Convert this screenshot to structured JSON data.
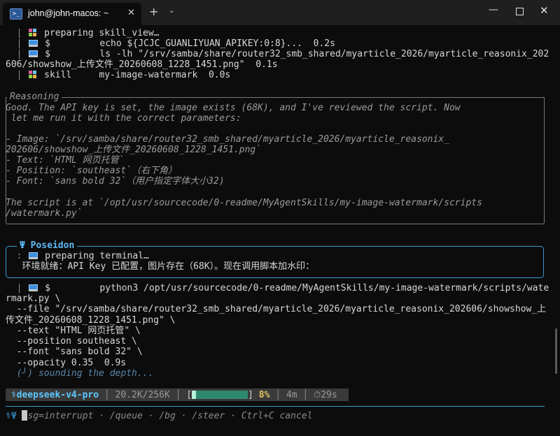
{
  "window": {
    "tab_icon": ">_",
    "tab_title": "john@john-macos: ~",
    "close_tab": "✕",
    "new_tab": "+",
    "dropdown": "⌄",
    "minimize": "—",
    "close": "✕"
  },
  "tool_calls": [
    {
      "pipe": "|",
      "icon": "package-icon",
      "cmd": "preparing skill_view…",
      "cont": ""
    },
    {
      "pipe": "|",
      "icon": "laptop-icon",
      "cmd": "$         echo ${JCJC_GUANLIYUAN_APIKEY:0:8}...  0.2s",
      "cont": ""
    },
    {
      "pipe": "|",
      "icon": "laptop-icon",
      "cmd": "$         ls -lh \"/srv/samba/share/router32_smb_shared/myarticle_2026/myarticle_reasonix_202",
      "cont": "606/showshow_上传文件_20260608_1228_1451.png\"  0.1s"
    },
    {
      "pipe": "|",
      "icon": "package-icon",
      "cmd": "skill     my-image-watermark  0.0s",
      "cont": ""
    }
  ],
  "reasoning": {
    "label": "Reasoning",
    "lines": [
      "Good. The API key is set, the image exists (68K), and I've reviewed the script. Now",
      " let me run it with the correct parameters:",
      "",
      "- Image: `/srv/samba/share/router32_smb_shared/myarticle_2026/myarticle_reasonix_",
      "202606/showshow_上传文件_20260608_1228_1451.png`",
      "- Text: `HTML 网页托管`",
      "- Position: `southeast`（右下角）",
      "- Font: `sans bold 32`（用户指定字体大小32)",
      "",
      "The script is at `/opt/usr/sourcecode/0-readme/MyAgentSkills/my-image-watermark/scripts",
      "/watermark.py`"
    ]
  },
  "poseidon": {
    "label": "Ψ Poseidon",
    "line1": "preparing terminal…",
    "line2": "环境就绪：API Key 已配置，图片存在（68K）。现在调用脚本加水印："
  },
  "command": {
    "lines": [
      "python3 /opt/usr/sourcecode/0-readme/MyAgentSkills/my-image-watermark/scripts/wate",
      "rmark.py \\",
      "  --file \"/srv/samba/share/router32_smb_shared/myarticle_2026/myarticle_reasonix_202606/showshow_上",
      "传文件_20260608_1228_1451.png\" \\",
      "  --text \"HTML 网页托管\" \\",
      "  --position southeast \\",
      "  --font \"sans bold 32\" \\",
      "  --opacity 0.35  0.9s"
    ],
    "prefix": "| ",
    "dollar": "$",
    "spinner": "(╯) sounding the depth..."
  },
  "status": {
    "model": "deepseek-v4-pro",
    "tokens": "20.2K/256K",
    "context_fraction": 0.08,
    "percent": "8%",
    "elapsed": "4m",
    "timer": "29s"
  },
  "prompt": {
    "symbol": "Ψ",
    "hint": "sg=interrupt · /queue · /bg · /steer · Ctrl+C cancel"
  }
}
